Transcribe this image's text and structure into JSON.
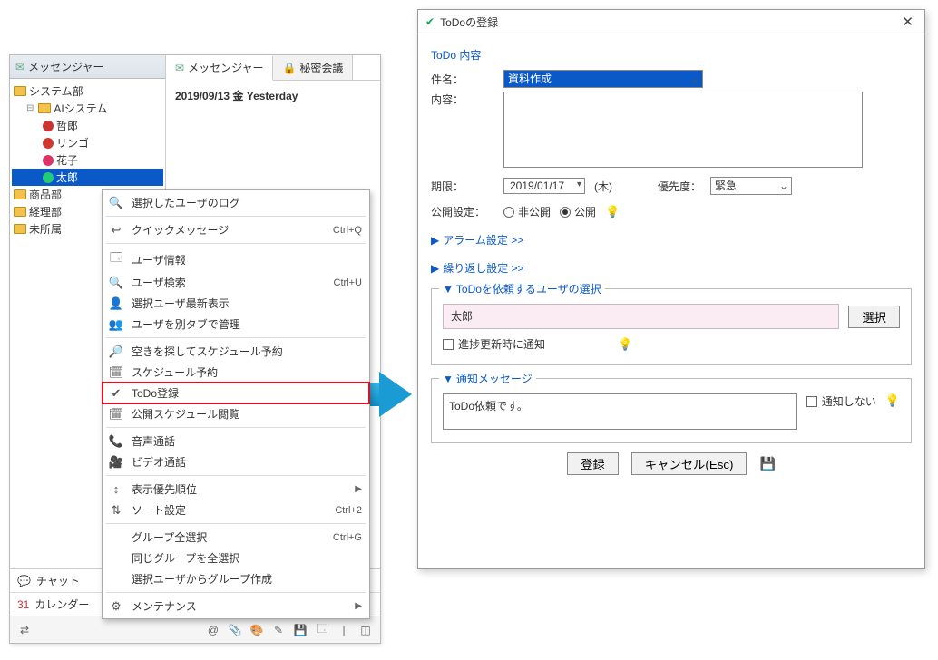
{
  "left": {
    "header": "メッセンジャー",
    "tree": {
      "root": "システム部",
      "aiSystem": "AIシステム",
      "users": [
        "哲郎",
        "リンゴ",
        "花子",
        "太郎"
      ],
      "depts": [
        "商品部",
        "経理部",
        "未所属"
      ]
    },
    "tabs": {
      "messenger": "メッセンジャー",
      "secret": "秘密会議"
    },
    "dateLine": "2019/09/13 金 Yesterday",
    "side": {
      "chat": "チャット",
      "calendar": "カレンダー"
    }
  },
  "ctx": {
    "items": [
      {
        "label": "選択したユーザのログ",
        "icon": "🔍"
      },
      {
        "sep": true
      },
      {
        "label": "クイックメッセージ",
        "icon": "↩",
        "sc": "Ctrl+Q"
      },
      {
        "sep": true
      },
      {
        "label": "ユーザ情報",
        "icon": "🗔"
      },
      {
        "label": "ユーザ検索",
        "icon": "🔍",
        "sc": "Ctrl+U"
      },
      {
        "label": "選択ユーザ最新表示",
        "icon": "👤"
      },
      {
        "label": "ユーザを別タブで管理",
        "icon": "👥"
      },
      {
        "sep": true
      },
      {
        "label": "空きを探してスケジュール予約",
        "icon": "🔎"
      },
      {
        "label": "スケジュール予約",
        "icon": "🗓"
      },
      {
        "label": "ToDo登録",
        "icon": "✔",
        "hl": true
      },
      {
        "label": "公開スケジュール閲覧",
        "icon": "🗓"
      },
      {
        "sep": true
      },
      {
        "label": "音声通話",
        "icon": "📞"
      },
      {
        "label": "ビデオ通話",
        "icon": "🎥"
      },
      {
        "sep": true
      },
      {
        "label": "表示優先順位",
        "icon": "↕",
        "sub": true
      },
      {
        "label": "ソート設定",
        "icon": "⇅",
        "sc": "Ctrl+2"
      },
      {
        "sep": true
      },
      {
        "label": "グループ全選択",
        "sc": "Ctrl+G"
      },
      {
        "label": "同じグループを全選択"
      },
      {
        "label": "選択ユーザからグループ作成"
      },
      {
        "sep": true
      },
      {
        "label": "メンテナンス",
        "icon": "⚙",
        "sub": true
      }
    ]
  },
  "dlg": {
    "title": "ToDoの登録",
    "section": "ToDo 内容",
    "subject_lbl": "件名：",
    "subject_val": "資料作成",
    "content_lbl": "内容：",
    "deadline_lbl": "期限：",
    "deadline_date": "2019/01/17",
    "deadline_day": "(木)",
    "priority_lbl": "優先度：",
    "priority_val": "緊急",
    "visibility_lbl": "公開設定：",
    "vis_private": "非公開",
    "vis_public": "公開",
    "alarm": "アラーム設定 >>",
    "repeat": "繰り返し設定 >>",
    "assign_title": "ToDoを依頼するユーザの選択",
    "assign_user": "太郎",
    "select_btn": "選択",
    "notify_progress": "進捗更新時に通知",
    "notify_title": "通知メッセージ",
    "notify_msg": "ToDo依頼です。",
    "no_notify": "通知しない",
    "register_btn": "登録",
    "cancel_btn": "キャンセル(Esc)"
  }
}
